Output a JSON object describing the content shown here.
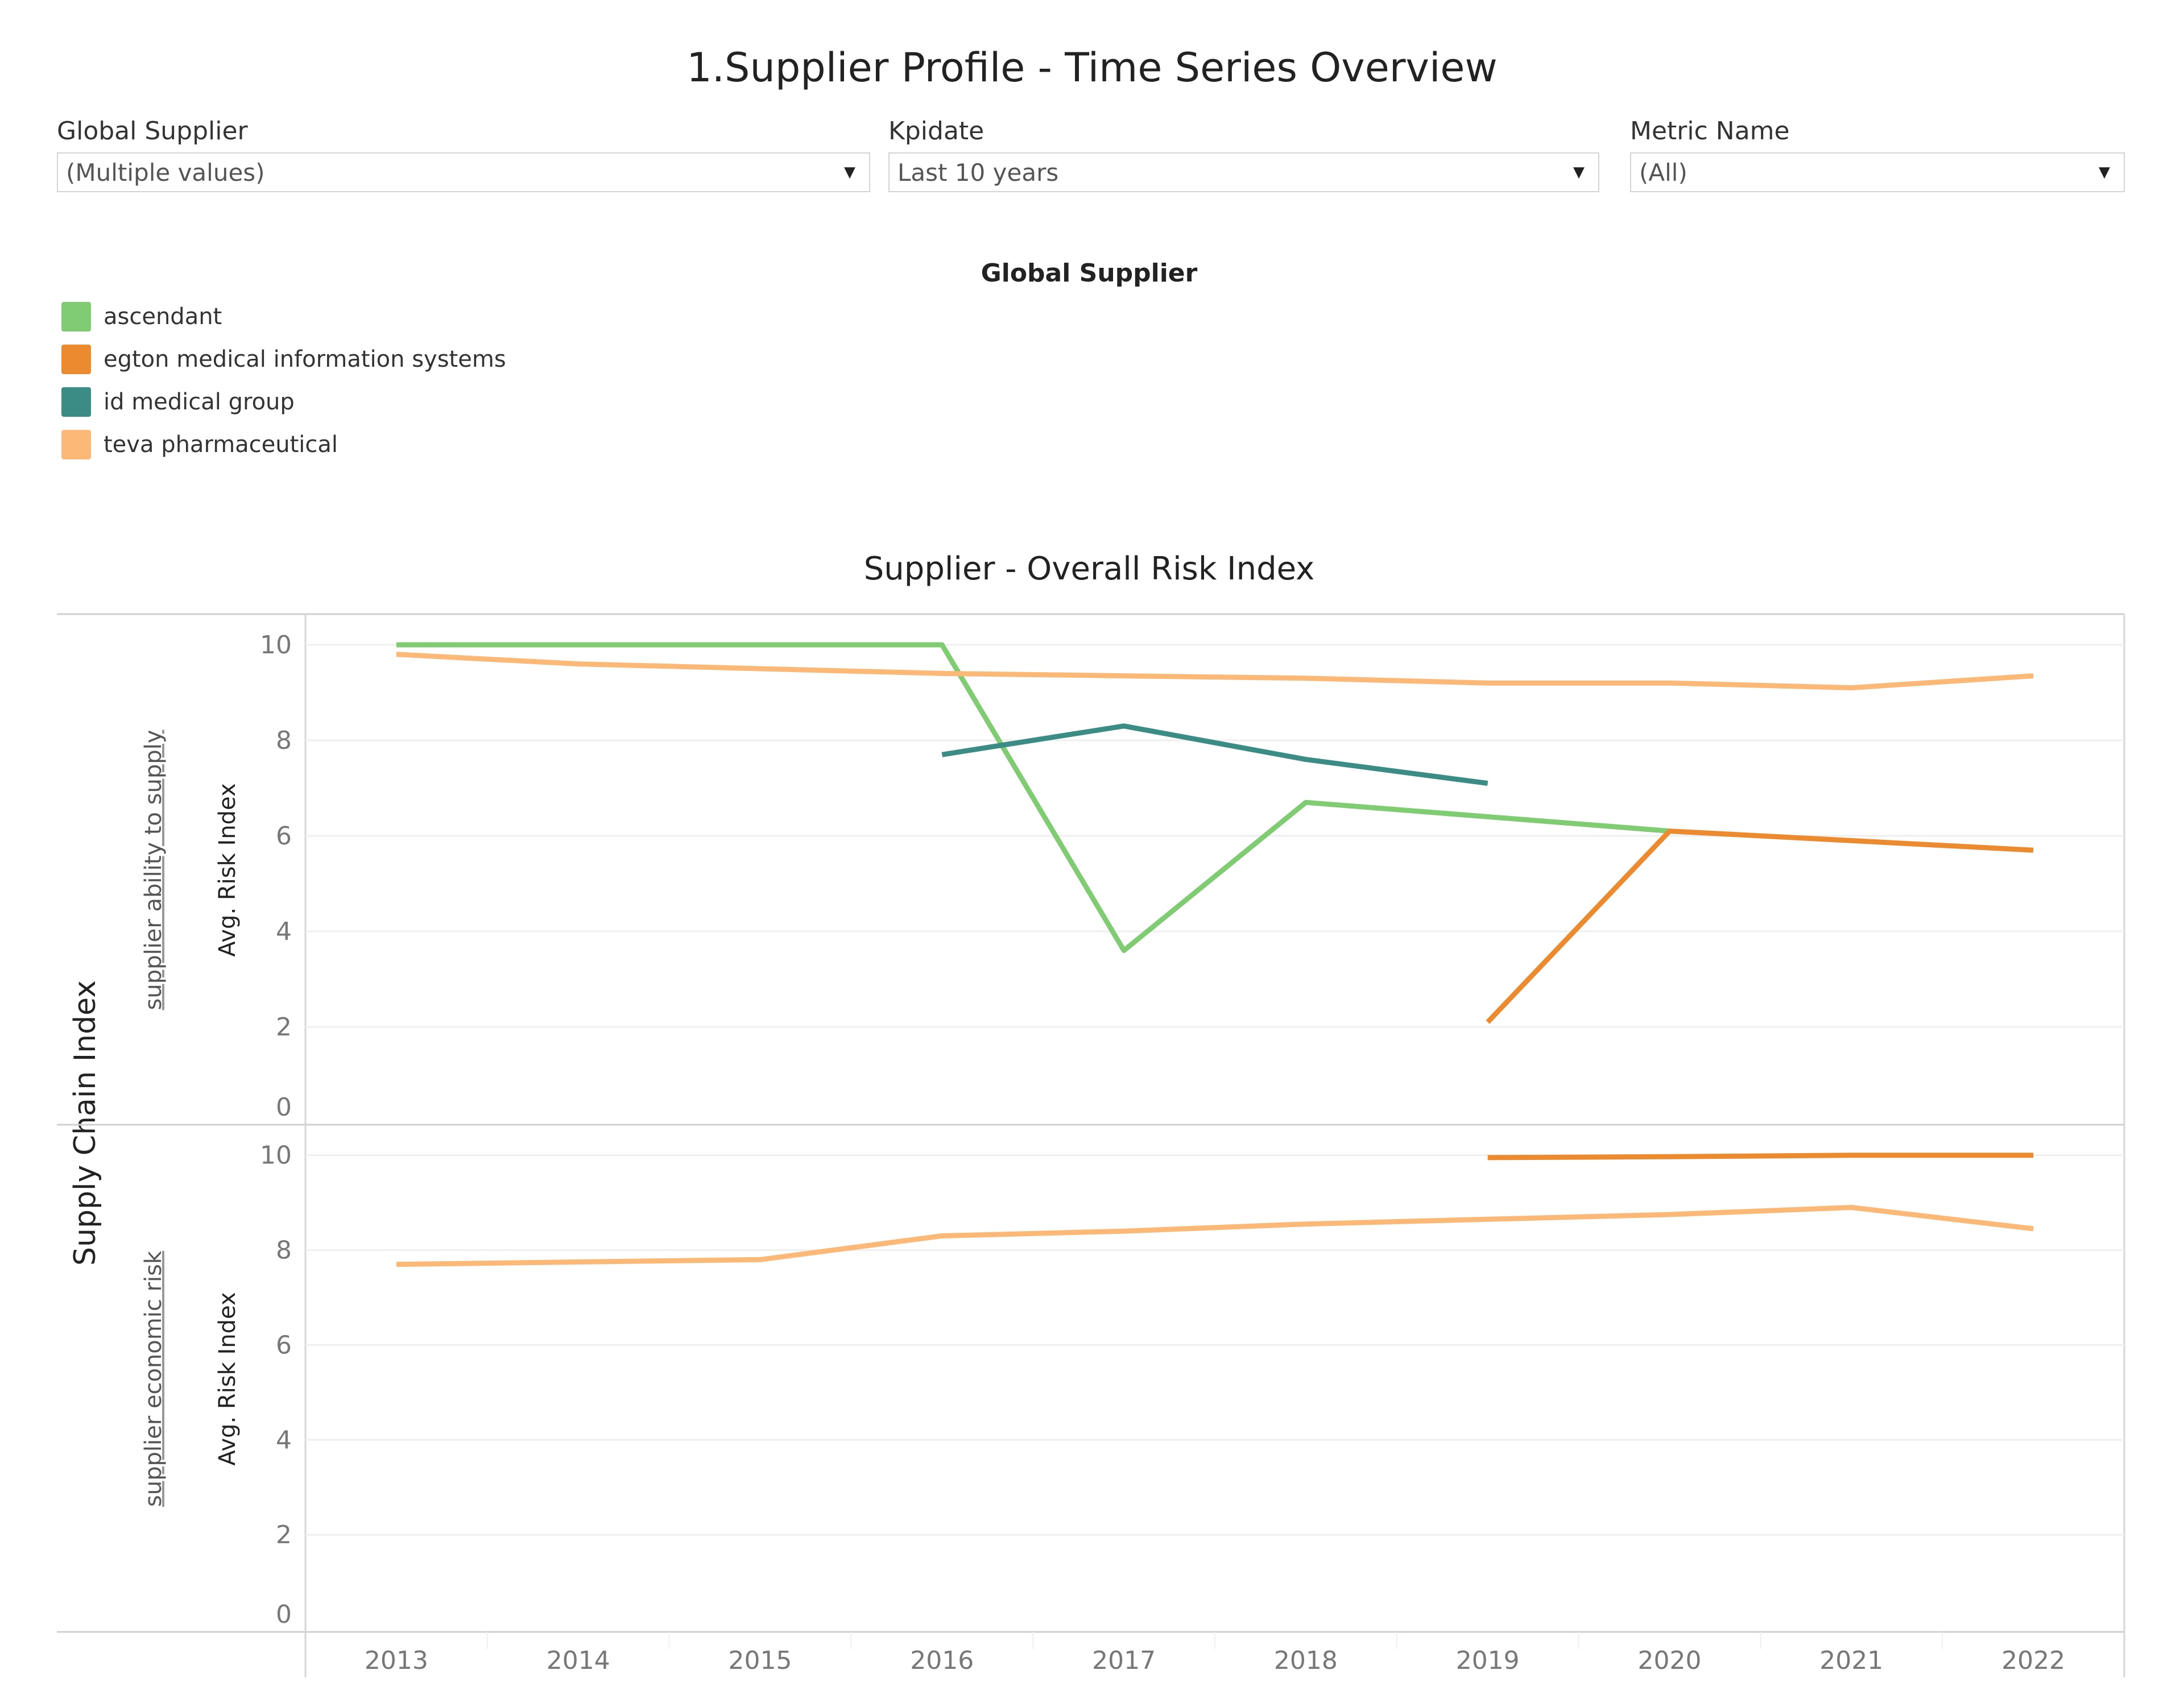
{
  "dashboard": {
    "title": "1.Supplier Profile - Time Series Overview"
  },
  "filters": [
    {
      "label": "Global Supplier",
      "value": "(Multiple values)",
      "icon": "dropdown-arrow-icon"
    },
    {
      "label": "Kpidate",
      "value": "Last 10 years",
      "icon": "dropdown-arrow-icon"
    },
    {
      "label": "Metric Name",
      "value": "(All)",
      "icon": "dropdown-arrow-icon"
    }
  ],
  "legend": {
    "title": "Global Supplier",
    "items": [
      {
        "label": "ascendant",
        "color": "#7fcc72"
      },
      {
        "label": "egton medical information systems",
        "color": "#ec8a2f"
      },
      {
        "label": "id medical group",
        "color": "#3c8c86"
      },
      {
        "label": "teva pharmaceutical",
        "color": "#fbb877"
      }
    ]
  },
  "chart_data": {
    "type": "line",
    "title": "Supplier - Overall Risk Index",
    "row_dimension_label": "Supply Chain Index",
    "x": [
      "2013",
      "2014",
      "2015",
      "2016",
      "2017",
      "2018",
      "2019",
      "2020",
      "2021",
      "2022"
    ],
    "xlabel": "",
    "grid": true,
    "legend_position": "top-left",
    "panels": [
      {
        "name": "supplier ability to supply",
        "ylabel": "Avg. Risk Index",
        "ylim": [
          0,
          10.5
        ],
        "yticks": [
          0,
          2,
          4,
          6,
          8,
          10
        ],
        "series": [
          {
            "name": "ascendant",
            "color": "#7fcc72",
            "values": [
              10.0,
              10.0,
              10.0,
              10.0,
              3.6,
              6.7,
              6.4,
              6.1,
              null,
              null
            ]
          },
          {
            "name": "egton medical information systems",
            "color": "#ec8a2f",
            "values": [
              null,
              null,
              null,
              null,
              null,
              null,
              2.1,
              6.1,
              5.9,
              5.7
            ]
          },
          {
            "name": "id medical group",
            "color": "#3c8c86",
            "values": [
              null,
              null,
              null,
              7.7,
              8.3,
              7.6,
              7.1,
              null,
              null,
              null
            ]
          },
          {
            "name": "teva pharmaceutical",
            "color": "#fbb877",
            "values": [
              9.8,
              9.6,
              9.5,
              9.4,
              9.35,
              9.3,
              9.2,
              9.2,
              9.1,
              9.35
            ]
          }
        ]
      },
      {
        "name": "supplier economic risk",
        "ylabel": "Avg. Risk Index",
        "ylim": [
          0,
          10.5
        ],
        "yticks": [
          0,
          2,
          4,
          6,
          8,
          10
        ],
        "series": [
          {
            "name": "egton medical information systems",
            "color": "#ec8a2f",
            "values": [
              null,
              null,
              null,
              null,
              null,
              null,
              9.95,
              9.97,
              10.0,
              10.0
            ]
          },
          {
            "name": "teva pharmaceutical",
            "color": "#fbb877",
            "values": [
              7.7,
              7.75,
              7.8,
              8.3,
              8.4,
              8.55,
              8.65,
              8.75,
              8.9,
              8.45
            ]
          }
        ]
      }
    ]
  }
}
